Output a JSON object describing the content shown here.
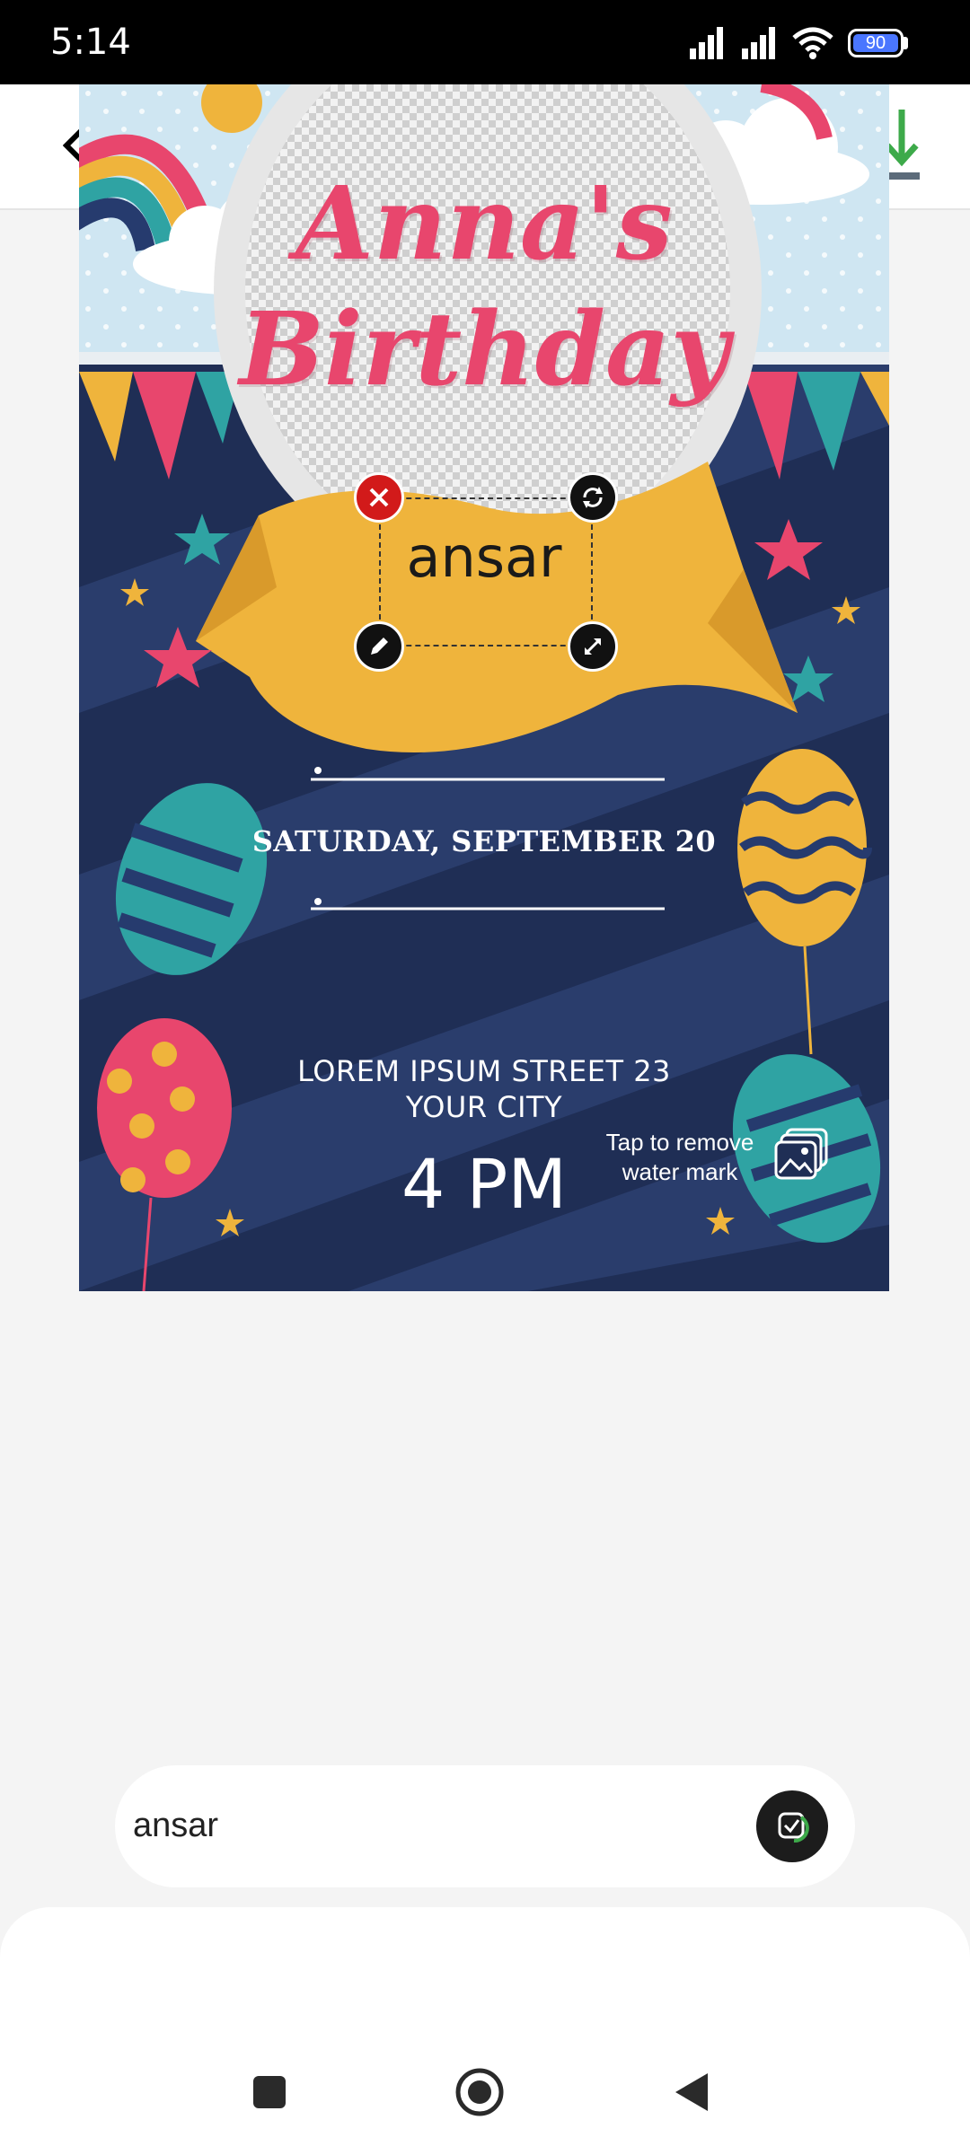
{
  "status_bar": {
    "time": "5:14",
    "battery": "90"
  },
  "card": {
    "title_line1": "Anna's",
    "title_line2": "Birthday",
    "ribbon_text": "ansar",
    "date": "SATURDAY, SEPTEMBER 20",
    "address_line1": "LOREM IPSUM STREET 23",
    "address_line2": "YOUR CITY",
    "time": "4 PM",
    "watermark_line1": "Tap to remove",
    "watermark_line2": "water mark"
  },
  "text_input": {
    "value": "ansar"
  },
  "colors": {
    "title_pink": "#e8466d",
    "ribbon_yellow": "#efb43c",
    "background_navy": "#1f2e55",
    "delete_red": "#d21a1a"
  }
}
